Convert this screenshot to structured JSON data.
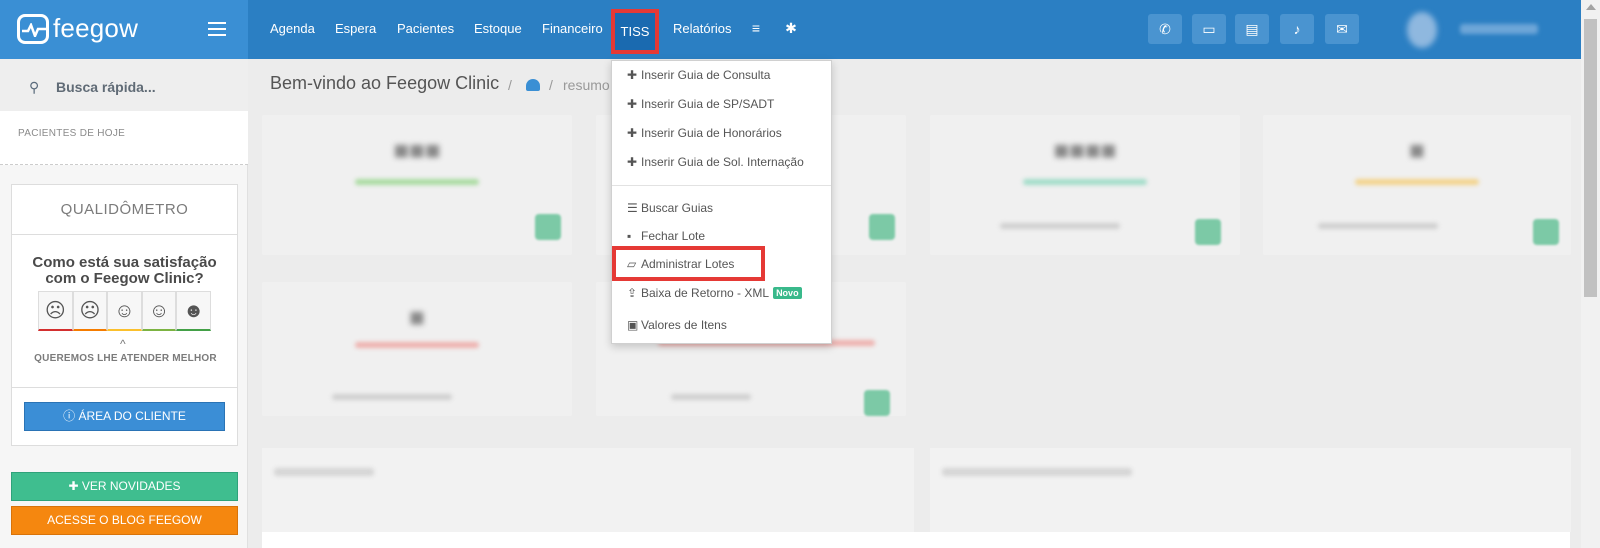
{
  "brand": {
    "name": "feegow"
  },
  "nav": {
    "items": [
      "Agenda",
      "Espera",
      "Pacientes",
      "Estoque",
      "Financeiro",
      "TISS",
      "Relatórios"
    ],
    "active": "TISS"
  },
  "sidebar": {
    "search_placeholder": "Busca rápida...",
    "today_label": "PACIENTES DE HOJE",
    "quali_title": "QUALIDÔMETRO",
    "quali_question": "Como está sua satisfação com o Feegow Clinic?",
    "quali_footer": "QUEREMOS LHE ATENDER MELHOR",
    "client_area_button": "ÁREA DO CLIENTE",
    "news_button": "VER NOVIDADES",
    "blog_button": "ACESSE O BLOG FEEGOW",
    "face_colors": [
      "#d32f2f",
      "#f57c00",
      "#fbc02d",
      "#7cb342",
      "#43a047"
    ]
  },
  "main": {
    "title": "Bem-vindo ao Feegow Clinic",
    "breadcrumb": "resumo"
  },
  "tiss_menu": {
    "items": [
      {
        "icon": "plus-icon",
        "label": "Inserir Guia de Consulta"
      },
      {
        "icon": "plus-icon",
        "label": "Inserir Guia de SP/SADT"
      },
      {
        "icon": "plus-icon",
        "label": "Inserir Guia de Honorários"
      },
      {
        "icon": "plus-icon",
        "label": "Inserir Guia de Sol. Internação"
      },
      {
        "icon": "list-icon",
        "label": "Buscar Guias"
      },
      {
        "icon": "archive-icon",
        "label": "Fechar Lote"
      },
      {
        "icon": "folder-open-icon",
        "label": "Administrar Lotes"
      },
      {
        "icon": "upload-icon",
        "label": "Baixa de Retorno - XML"
      },
      {
        "icon": "money-icon",
        "label": "Valores de Itens"
      }
    ],
    "new_badge": "Novo",
    "highlighted": "Administrar Lotes"
  },
  "colors": {
    "topbar": "#2b7fc3",
    "highlight": "#e53935",
    "success": "#3fbe8f",
    "warning": "#f5870f",
    "primary": "#3b8ed6"
  }
}
